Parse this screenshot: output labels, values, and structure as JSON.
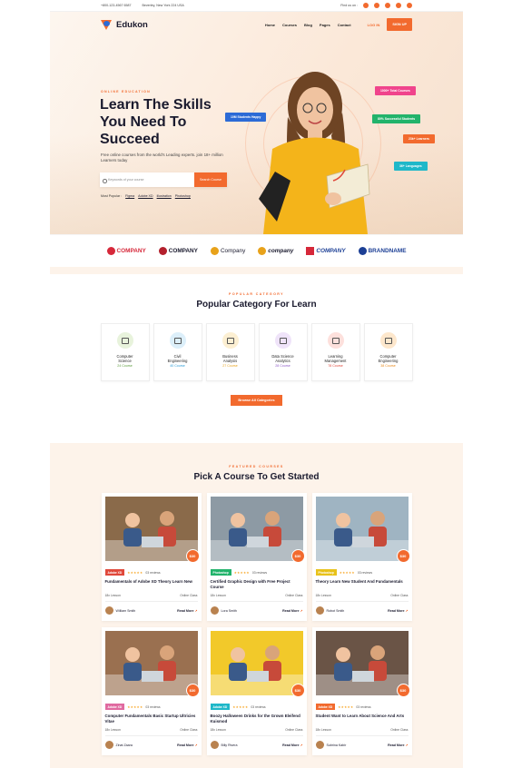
{
  "topbar": {
    "phone": "+800-123-4567 6587",
    "address": "Beverley, New York 224 USA",
    "find_us": "Find us on :"
  },
  "header": {
    "logo": "Edukon",
    "menu": [
      "Home",
      "Courses",
      "Blog",
      "Pages",
      "Contact"
    ],
    "login": "LOG IN",
    "signup": "SIGN UP"
  },
  "hero": {
    "eyebrow": "ONLINE EDUCATION",
    "title": "Learn The Skills You Need To Succeed",
    "subtitle": "Free online courses from the world's Leading experts. join 18+ million Learners today",
    "search_placeholder": "Keywords of your course",
    "search_button": "Search Course",
    "popular_label": "Most Popular :",
    "popular_tags": [
      "Figma",
      "Adobe XD",
      "illustration",
      "Photoshop"
    ],
    "pills": [
      {
        "text": "1000+ Total Courses",
        "color": "#f0448c"
      },
      {
        "text": "10M Students Happy",
        "color": "#2c6bd6"
      },
      {
        "text": "80% Successful Students",
        "color": "#22b36b"
      },
      {
        "text": "23k+ Learners",
        "color": "#f26a2e"
      },
      {
        "text": "36+ Languages",
        "color": "#1fb8c9"
      }
    ]
  },
  "brands": [
    {
      "name": "COMPANY",
      "color": "#d6283a"
    },
    {
      "name": "COMPANY",
      "color": "#b3202d"
    },
    {
      "name": "Company",
      "color": "#e8a21a"
    },
    {
      "name": "company",
      "color": "#1a1a2e"
    },
    {
      "name": "COMPANY",
      "color": "#1c3f95"
    },
    {
      "name": "BRANDNAME",
      "color": "#1c3f95"
    }
  ],
  "categories": {
    "eyebrow": "POPULAR CATEGORY",
    "title": "Popular Category For Learn",
    "items": [
      {
        "name1": "Computer",
        "name2": "Science",
        "count": "24 Course",
        "color": "#5a9a3a",
        "bg": "#e8f3dc"
      },
      {
        "name1": "Civil",
        "name2": "Engineering",
        "count": "40 Course",
        "color": "#2a9bd6",
        "bg": "#dceffa"
      },
      {
        "name1": "Business",
        "name2": "Analysis",
        "count": "27 Course",
        "color": "#e8a21a",
        "bg": "#fcefd2"
      },
      {
        "name1": "Data Science",
        "name2": "Analytics",
        "count": "28 Course",
        "color": "#8e5bc7",
        "bg": "#efe3f9"
      },
      {
        "name1": "Learning",
        "name2": "Management",
        "count": "78 Course",
        "color": "#e0483a",
        "bg": "#fde0dc"
      },
      {
        "name1": "Computer",
        "name2": "Engineering",
        "count": "38 Course",
        "color": "#e8881a",
        "bg": "#fde7cc"
      }
    ],
    "browse": "Browse All Categories"
  },
  "courses": {
    "eyebrow": "FEATURED COURSES",
    "title": "Pick A Course To Get Started",
    "items": [
      {
        "tag": "Adobe XD",
        "tag_color": "#e0483a",
        "reviews": "03 reviews",
        "title": "Fundamentals of Adobe XD Theory Learn New",
        "lessons": "18x Lesson",
        "mode": "Online Class",
        "author": "William Smith",
        "read": "Read More",
        "price": "$30",
        "bg": "#8a6a4a"
      },
      {
        "tag": "Photoshop",
        "tag_color": "#22b36b",
        "reviews": "03 reviews",
        "title": "Certified Graphic Design with Free Project Course",
        "lessons": "18x Lesson",
        "mode": "Online Class",
        "author": "Lora Smith",
        "read": "Read More",
        "price": "$30",
        "bg": "#8d9aa4"
      },
      {
        "tag": "Photoshop",
        "tag_color": "#e8c21a",
        "reviews": "03 reviews",
        "title": "Theory Learn New Student And Fundamentals",
        "lessons": "18x Lesson",
        "mode": "Online Class",
        "author": "Robot Smith",
        "read": "Read More",
        "price": "$30",
        "bg": "#9fb4c2"
      },
      {
        "tag": "Adobe XD",
        "tag_color": "#e06aa0",
        "reviews": "03 reviews",
        "title": "Computer Fundamentals Basic Startup Ultricies Vitae",
        "lessons": "18x Lesson",
        "mode": "Online Class",
        "author": "Zinat Zaara",
        "read": "Read More",
        "price": "$30",
        "bg": "#9a7050"
      },
      {
        "tag": "Adobe XD",
        "tag_color": "#1fb8c9",
        "reviews": "03 reviews",
        "title": "Boozy Halloween Drinks for the Grown Eleifend Kuismod",
        "lessons": "18x Lesson",
        "mode": "Online Class",
        "author": "Billy Rivera",
        "read": "Read More",
        "price": "$30",
        "bg": "#f2c92a"
      },
      {
        "tag": "Adobe XD",
        "tag_color": "#f26a2e",
        "reviews": "03 reviews",
        "title": "Student Want to Learn About Science And Arts",
        "lessons": "18x Lesson",
        "mode": "Online Class",
        "author": "Subrina Kabir",
        "read": "Read More",
        "price": "$30",
        "bg": "#6a5446"
      }
    ]
  },
  "accent": "#f26a2e"
}
